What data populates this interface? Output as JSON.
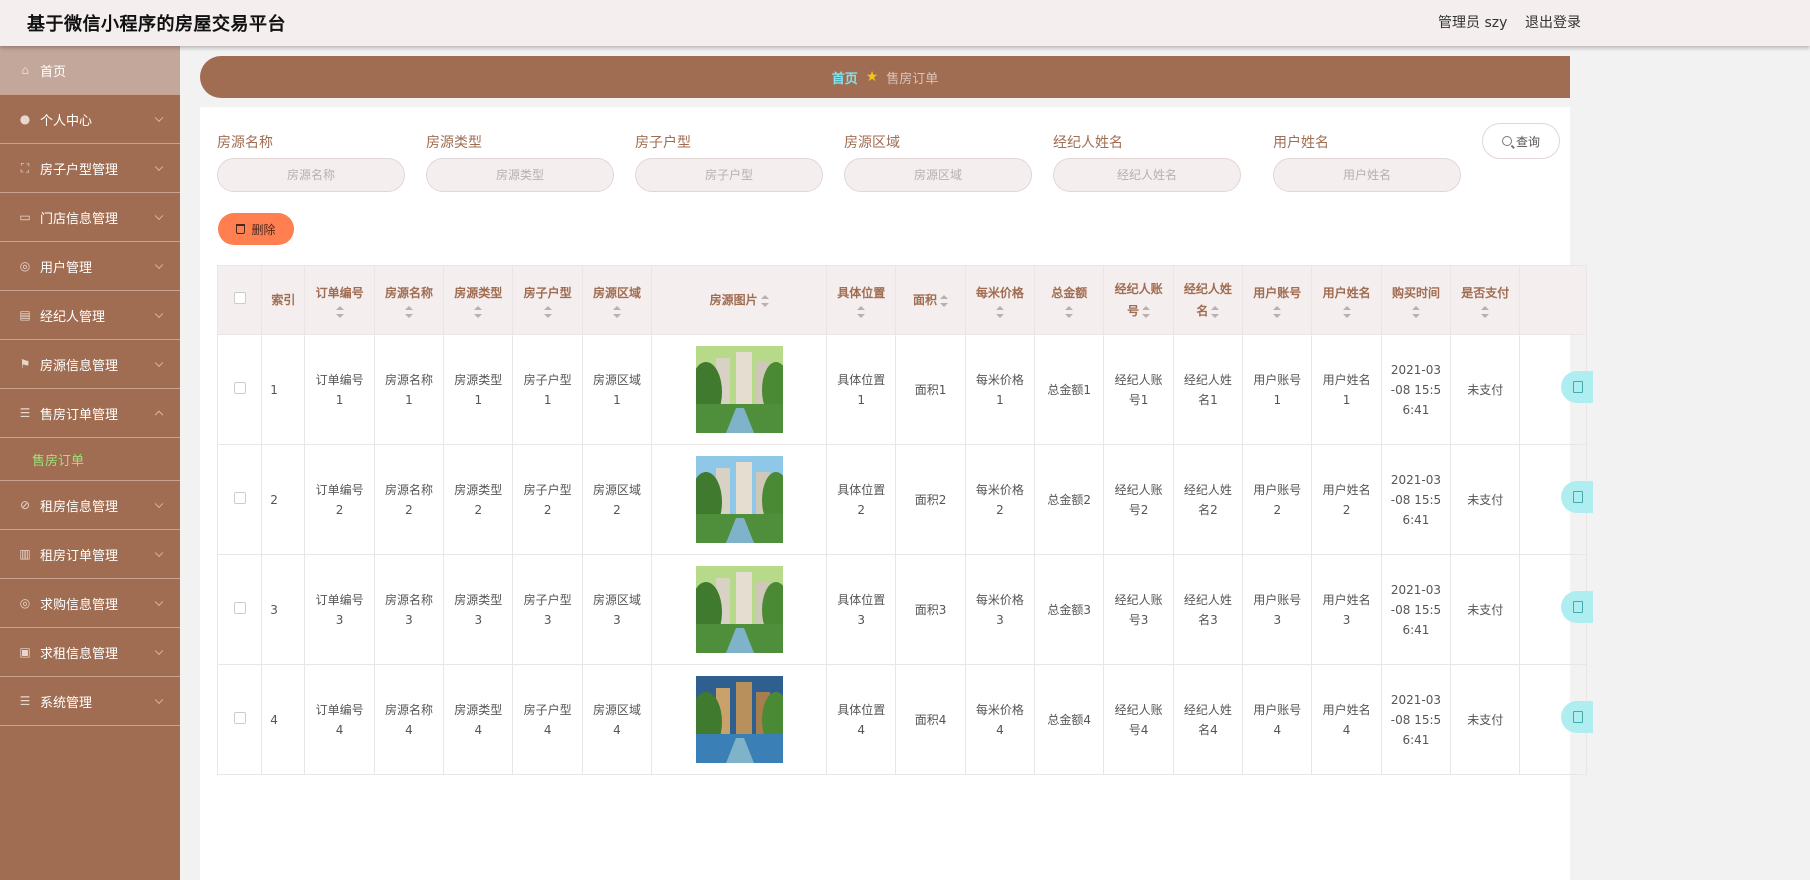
{
  "app": {
    "title": "基于微信小程序的房屋交易平台",
    "admin_label": "管理员 szy",
    "logout_label": "退出登录"
  },
  "sidebar": {
    "items": [
      {
        "label": "首页",
        "icon": "home-icon"
      },
      {
        "label": "个人中心",
        "icon": "user-icon"
      },
      {
        "label": "房子户型管理",
        "icon": "frame-icon"
      },
      {
        "label": "门店信息管理",
        "icon": "monitor-icon"
      },
      {
        "label": "用户管理",
        "icon": "compass-icon"
      },
      {
        "label": "经纪人管理",
        "icon": "clipboard-icon"
      },
      {
        "label": "房源信息管理",
        "icon": "flag-icon"
      },
      {
        "label": "售房订单管理",
        "icon": "list-icon"
      },
      {
        "label": "租房信息管理",
        "icon": "no-icon"
      },
      {
        "label": "租房订单管理",
        "icon": "chart-icon"
      },
      {
        "label": "求购信息管理",
        "icon": "compass-icon"
      },
      {
        "label": "求租信息管理",
        "icon": "calc-icon"
      },
      {
        "label": "系统管理",
        "icon": "list-icon"
      }
    ],
    "sub_item": "售房订单"
  },
  "breadcrumb": {
    "home": "首页",
    "current": "售房订单"
  },
  "filters": [
    {
      "label": "房源名称",
      "placeholder": "房源名称"
    },
    {
      "label": "房源类型",
      "placeholder": "房源类型"
    },
    {
      "label": "房子户型",
      "placeholder": "房子户型"
    },
    {
      "label": "房源区域",
      "placeholder": "房源区域"
    },
    {
      "label": "经纪人姓名",
      "placeholder": "经纪人姓名"
    },
    {
      "label": "用户姓名",
      "placeholder": "用户姓名"
    }
  ],
  "search_label": "查询",
  "delete_label": "删除",
  "table": {
    "headers": {
      "index": "索引",
      "order_no": "订单编号",
      "name": "房源名称",
      "type": "房源类型",
      "layout": "房子户型",
      "area_region": "房源区域",
      "image": "房源图片",
      "location": "具体位置",
      "size": "面积",
      "unit_price": "每米价格",
      "total": "总金额",
      "agent_acct_a": "经纪人账",
      "agent_acct_b": "号",
      "agent_name_a": "经纪人姓",
      "agent_name_b": "名",
      "user_acct": "用户账号",
      "user_name": "用户姓名",
      "buy_time": "购买时间",
      "paid": "是否支付"
    },
    "rows": [
      {
        "index": "1",
        "order_a": "订单编号",
        "order_b": "1",
        "name_a": "房源名称",
        "name_b": "1",
        "type_a": "房源类型",
        "type_b": "1",
        "layout_a": "房子户型",
        "layout_b": "1",
        "region_a": "房源区域",
        "region_b": "1",
        "loc_a": "具体位置",
        "loc_b": "1",
        "size": "面积1",
        "price_a": "每米价格",
        "price_b": "1",
        "total": "总金额1",
        "acct_a": "经纪人账",
        "acct_b": "号1",
        "aname_a": "经纪人姓",
        "aname_b": "名1",
        "uacct_a": "用户账号",
        "uacct_b": "1",
        "uname_a": "用户姓名",
        "uname_b": "1",
        "time_a": "2021-03",
        "time_b": "-08 15:5",
        "time_c": "6:41",
        "paid": "未支付"
      },
      {
        "index": "2",
        "order_a": "订单编号",
        "order_b": "2",
        "name_a": "房源名称",
        "name_b": "2",
        "type_a": "房源类型",
        "type_b": "2",
        "layout_a": "房子户型",
        "layout_b": "2",
        "region_a": "房源区域",
        "region_b": "2",
        "loc_a": "具体位置",
        "loc_b": "2",
        "size": "面积2",
        "price_a": "每米价格",
        "price_b": "2",
        "total": "总金额2",
        "acct_a": "经纪人账",
        "acct_b": "号2",
        "aname_a": "经纪人姓",
        "aname_b": "名2",
        "uacct_a": "用户账号",
        "uacct_b": "2",
        "uname_a": "用户姓名",
        "uname_b": "2",
        "time_a": "2021-03",
        "time_b": "-08 15:5",
        "time_c": "6:41",
        "paid": "未支付"
      },
      {
        "index": "3",
        "order_a": "订单编号",
        "order_b": "3",
        "name_a": "房源名称",
        "name_b": "3",
        "type_a": "房源类型",
        "type_b": "3",
        "layout_a": "房子户型",
        "layout_b": "3",
        "region_a": "房源区域",
        "region_b": "3",
        "loc_a": "具体位置",
        "loc_b": "3",
        "size": "面积3",
        "price_a": "每米价格",
        "price_b": "3",
        "total": "总金额3",
        "acct_a": "经纪人账",
        "acct_b": "号3",
        "aname_a": "经纪人姓",
        "aname_b": "名3",
        "uacct_a": "用户账号",
        "uacct_b": "3",
        "uname_a": "用户姓名",
        "uname_b": "3",
        "time_a": "2021-03",
        "time_b": "-08 15:5",
        "time_c": "6:41",
        "paid": "未支付"
      },
      {
        "index": "4",
        "order_a": "订单编号",
        "order_b": "4",
        "name_a": "房源名称",
        "name_b": "4",
        "type_a": "房源类型",
        "type_b": "4",
        "layout_a": "房子户型",
        "layout_b": "4",
        "region_a": "房源区域",
        "region_b": "4",
        "loc_a": "具体位置",
        "loc_b": "4",
        "size": "面积4",
        "price_a": "每米价格",
        "price_b": "4",
        "total": "总金额4",
        "acct_a": "经纪人账",
        "acct_b": "号4",
        "aname_a": "经纪人姓",
        "aname_b": "名4",
        "uacct_a": "用户账号",
        "uacct_b": "4",
        "uname_a": "用户姓名",
        "uname_b": "4",
        "time_a": "2021-03",
        "time_b": "-08 15:5",
        "time_c": "6:41",
        "paid": "未支付"
      }
    ]
  }
}
